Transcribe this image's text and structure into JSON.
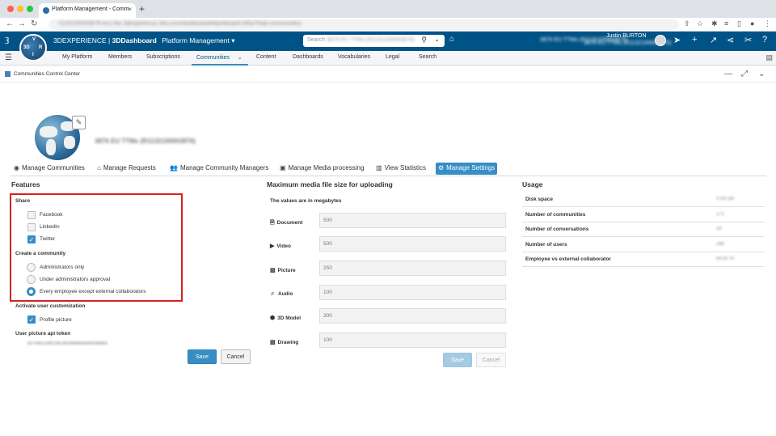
{
  "browser": {
    "tab_title": "Platform Management - Comm",
    "url": "r1132100003876-eu1-the.3dexperience.3ds.com/dashboard/#dashboard:c95a7f/tab:communities",
    "new_tab": "+"
  },
  "topbar": {
    "brand_prefix": "3DEXPERIENCE",
    "brand_sep": " | ",
    "brand_app": "3DDashboard",
    "dashboard_name": "Platform Management",
    "search_placeholder": "Search",
    "search_context_blurred": "3876 EU TTMs (R1132100003876)",
    "context_blurred": "3876 EU TTMs (R1132100003876)",
    "user_name": "Justin BURTON",
    "user_context_blurred": "3876 EU TTMs (R1132100003876)",
    "compass_labels": [
      "3D",
      "V",
      "R",
      "I"
    ]
  },
  "nav": {
    "items": [
      "My Platform",
      "Members",
      "Subscriptions",
      "Communities",
      "Content",
      "Dashboards",
      "Vocabularies",
      "Legal",
      "Search"
    ],
    "active": "Communities"
  },
  "widget": {
    "title": "Communities Control Center"
  },
  "community": {
    "name_blurred": "3876 EU TTMs (R1132100003876)"
  },
  "tabs": [
    {
      "label": "Manage Communities",
      "icon": "globe-icon"
    },
    {
      "label": "Manage Requests",
      "icon": "home-icon"
    },
    {
      "label": "Manage Community Managers",
      "icon": "users-icon"
    },
    {
      "label": "Manage Media processing",
      "icon": "image-icon"
    },
    {
      "label": "View Statistics",
      "icon": "bar-chart-icon"
    },
    {
      "label": "Manage Settings",
      "icon": "gear-icon",
      "active": true
    }
  ],
  "features": {
    "title": "Features",
    "share_label": "Share",
    "share_options": [
      {
        "label": "Facebook",
        "checked": false
      },
      {
        "label": "LinkedIn",
        "checked": false
      },
      {
        "label": "Twitter",
        "checked": true
      }
    ],
    "create_label": "Create a community",
    "create_options": [
      {
        "label": "Administrators only",
        "selected": false
      },
      {
        "label": "Under administrators approval",
        "selected": false
      },
      {
        "label": "Every employee except external collaborators",
        "selected": true
      }
    ],
    "activate_label": "Activate user customization",
    "profile_picture": {
      "label": "Profile picture",
      "checked": true
    },
    "token_label": "User picture api token",
    "token_value_blurred": "1870e5238f23fc3e0966ba084408db4",
    "save": "Save",
    "cancel": "Cancel"
  },
  "media": {
    "title": "Maximum media file size for uploading",
    "note": "The values are in megabytes",
    "rows": [
      {
        "label": "Document",
        "icon": "document-icon",
        "placeholder": "500"
      },
      {
        "label": "Video",
        "icon": "play-icon",
        "placeholder": "500"
      },
      {
        "label": "Picture",
        "icon": "picture-icon",
        "placeholder": "250"
      },
      {
        "label": "Audio",
        "icon": "music-icon",
        "placeholder": "100"
      },
      {
        "label": "3D Model",
        "icon": "cube-icon",
        "placeholder": "300"
      },
      {
        "label": "Drawing",
        "icon": "drawing-icon",
        "placeholder": "100"
      }
    ],
    "save": "Save",
    "cancel": "Cancel"
  },
  "usage": {
    "title": "Usage",
    "rows": [
      {
        "label": "Disk space",
        "value_blurred": "0.59 GB"
      },
      {
        "label": "Number of communities",
        "value_blurred": "172"
      },
      {
        "label": "Number of conversations",
        "value_blurred": "33"
      },
      {
        "label": "Number of users",
        "value_blurred": "266"
      },
      {
        "label": "Employee vs external collaborator",
        "value_blurred": "94.62 %"
      }
    ]
  },
  "colors": {
    "topbar": "#005386",
    "accent": "#368ec4",
    "highlight_box": "#d92020"
  }
}
